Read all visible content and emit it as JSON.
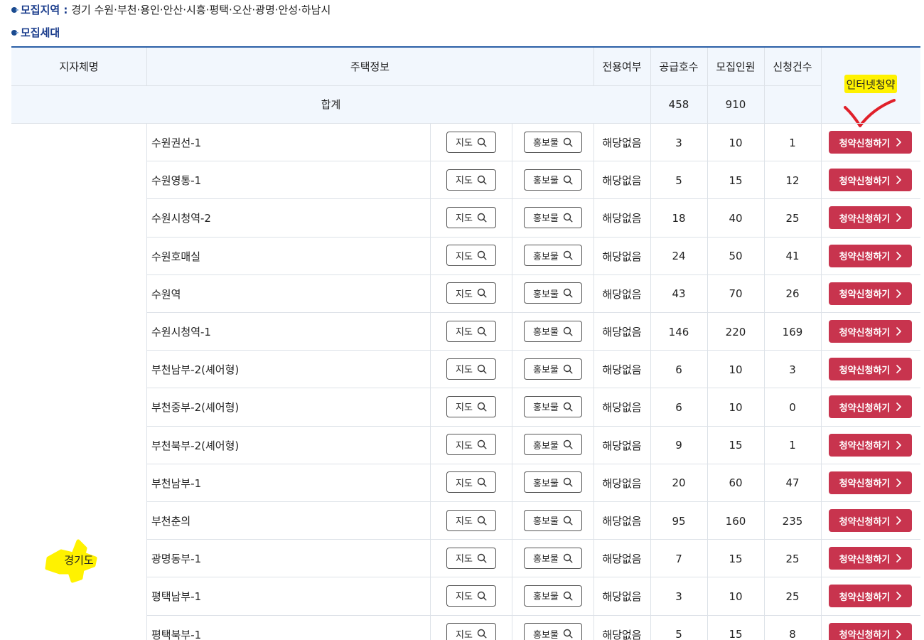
{
  "info": {
    "region_label": "모집지역 :",
    "region_value": "경기 수원·부천·용인·안산·시흥·평택·오산·광명·안성·하남시",
    "section_title": "모집세대"
  },
  "table": {
    "headers": {
      "region": "지자체명",
      "housing_info": "주택정보",
      "exclusive": "전용여부",
      "supply": "공급호수",
      "recruit": "모집인원",
      "applications": "신청건수",
      "internet": "인터넷청약"
    },
    "totals": {
      "label": "합계",
      "supply": "458",
      "recruit": "910",
      "applications": ""
    },
    "region_name": "경기도",
    "map_label": "지도",
    "promo_label": "홍보물",
    "apply_label": "청약신청하기",
    "rows": [
      {
        "name": "수원권선-1",
        "exclusive": "해당없음",
        "supply": "3",
        "recruit": "10",
        "applications": "1"
      },
      {
        "name": "수원영통-1",
        "exclusive": "해당없음",
        "supply": "5",
        "recruit": "15",
        "applications": "12"
      },
      {
        "name": "수원시청역-2",
        "exclusive": "해당없음",
        "supply": "18",
        "recruit": "40",
        "applications": "25"
      },
      {
        "name": "수원호매실",
        "exclusive": "해당없음",
        "supply": "24",
        "recruit": "50",
        "applications": "41"
      },
      {
        "name": "수원역",
        "exclusive": "해당없음",
        "supply": "43",
        "recruit": "70",
        "applications": "26"
      },
      {
        "name": "수원시청역-1",
        "exclusive": "해당없음",
        "supply": "146",
        "recruit": "220",
        "applications": "169"
      },
      {
        "name": "부천남부-2(셰어형)",
        "exclusive": "해당없음",
        "supply": "6",
        "recruit": "10",
        "applications": "3"
      },
      {
        "name": "부천중부-2(셰어형)",
        "exclusive": "해당없음",
        "supply": "6",
        "recruit": "10",
        "applications": "0"
      },
      {
        "name": "부천북부-2(셰어형)",
        "exclusive": "해당없음",
        "supply": "9",
        "recruit": "15",
        "applications": "1"
      },
      {
        "name": "부천남부-1",
        "exclusive": "해당없음",
        "supply": "20",
        "recruit": "60",
        "applications": "47"
      },
      {
        "name": "부천춘의",
        "exclusive": "해당없음",
        "supply": "95",
        "recruit": "160",
        "applications": "235"
      },
      {
        "name": "광명동부-1",
        "exclusive": "해당없음",
        "supply": "7",
        "recruit": "15",
        "applications": "25"
      },
      {
        "name": "평택남부-1",
        "exclusive": "해당없음",
        "supply": "3",
        "recruit": "10",
        "applications": "25"
      },
      {
        "name": "평택북부-1",
        "exclusive": "해당없음",
        "supply": "5",
        "recruit": "15",
        "applications": "8"
      }
    ]
  },
  "colors": {
    "accent_blue": "#1a3c8c",
    "table_top_border": "#2b5fa6",
    "header_bg": "#f2f7fd",
    "apply_button": "#c8344e",
    "highlight": "#fff200",
    "annotation_red": "#e0202a"
  },
  "icons": {
    "map": "search-icon",
    "promo": "search-icon",
    "apply": "chevron-right-icon"
  }
}
